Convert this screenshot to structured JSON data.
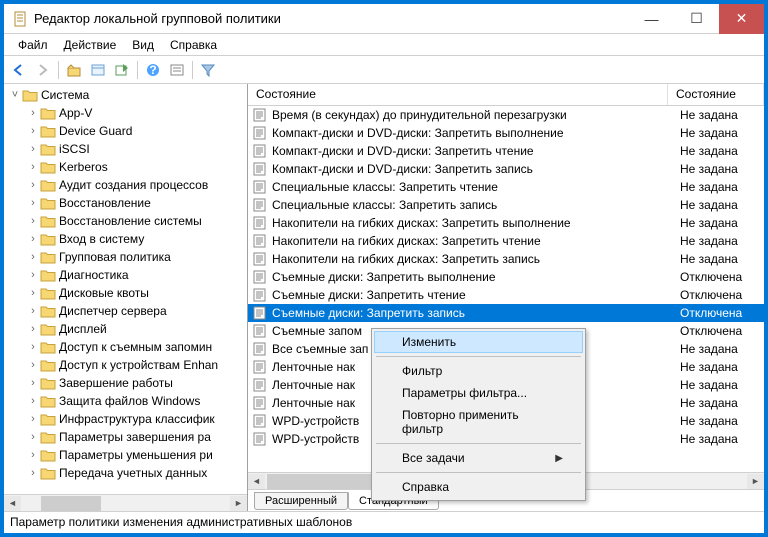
{
  "window": {
    "title": "Редактор локальной групповой политики"
  },
  "menubar": [
    "Файл",
    "Действие",
    "Вид",
    "Справка"
  ],
  "tree": {
    "root": "Система",
    "items": [
      "App-V",
      "Device Guard",
      "iSCSI",
      "Kerberos",
      "Аудит создания процессов",
      "Восстановление",
      "Восстановление системы",
      "Вход в систему",
      "Групповая политика",
      "Диагностика",
      "Дисковые квоты",
      "Диспетчер сервера",
      "Дисплей",
      "Доступ к съемным запомин",
      "Доступ к устройствам Enhan",
      "Завершение работы",
      "Защита файлов Windows",
      "Инфраструктура классифик",
      "Параметры завершения ра",
      "Параметры уменьшения ри",
      "Передача учетных данных"
    ]
  },
  "list": {
    "headers": [
      "Состояние",
      "Состояние"
    ],
    "rows": [
      {
        "label": "Время (в секундах) до принудительной перезагрузки",
        "state": "Не задана"
      },
      {
        "label": "Компакт-диски и DVD-диски: Запретить выполнение",
        "state": "Не задана"
      },
      {
        "label": "Компакт-диски и DVD-диски: Запретить чтение",
        "state": "Не задана"
      },
      {
        "label": "Компакт-диски и DVD-диски: Запретить запись",
        "state": "Не задана"
      },
      {
        "label": "Специальные классы: Запретить чтение",
        "state": "Не задана"
      },
      {
        "label": "Специальные классы: Запретить запись",
        "state": "Не задана"
      },
      {
        "label": "Накопители на гибких дисках: Запретить выполнение",
        "state": "Не задана"
      },
      {
        "label": "Накопители на гибких дисках: Запретить чтение",
        "state": "Не задана"
      },
      {
        "label": "Накопители на гибких дисках: Запретить запись",
        "state": "Не задана"
      },
      {
        "label": "Съемные диски: Запретить выполнение",
        "state": "Отключена"
      },
      {
        "label": "Съемные диски: Запретить чтение",
        "state": "Отключена"
      },
      {
        "label": "Съемные диски: Запретить запись",
        "state": "Отключена",
        "selected": true
      },
      {
        "label": "Съемные запом",
        "state": "Отключена"
      },
      {
        "label": "Все съемные зап",
        "state": "Не задана"
      },
      {
        "label": "Ленточные нак",
        "state": "Не задана"
      },
      {
        "label": "Ленточные нак",
        "state": "Не задана"
      },
      {
        "label": "Ленточные нак",
        "state": "Не задана"
      },
      {
        "label": "WPD-устройств",
        "state": "Не задана"
      },
      {
        "label": "WPD-устройств",
        "state": "Не задана"
      }
    ]
  },
  "tabs": [
    "Расширенный",
    "Стандартный"
  ],
  "statusbar": "Параметр политики изменения административных шаблонов",
  "context_menu": [
    {
      "label": "Изменить",
      "hover": true
    },
    {
      "type": "sep"
    },
    {
      "label": "Фильтр"
    },
    {
      "label": "Параметры фильтра..."
    },
    {
      "label": "Повторно применить фильтр",
      "disabled": true
    },
    {
      "type": "sep"
    },
    {
      "label": "Все задачи",
      "submenu": true
    },
    {
      "type": "sep"
    },
    {
      "label": "Справка"
    }
  ]
}
